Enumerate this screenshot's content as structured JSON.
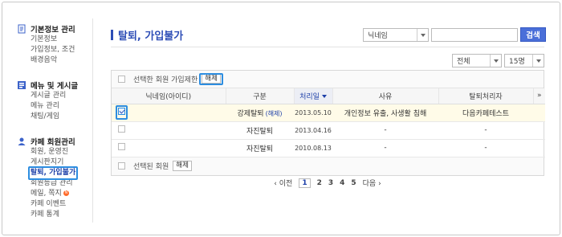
{
  "sidebar": {
    "sections": [
      {
        "title": "기본정보 관리",
        "items": [
          "기본정보",
          "가입정보, 조건",
          "배경음악"
        ]
      },
      {
        "title": "메뉴 및 게시글",
        "items": [
          "게시글 관리",
          "메뉴 관리",
          "채팅/게임"
        ]
      },
      {
        "title": "카페 회원관리",
        "items": [
          "회원, 운영진",
          "게시판지기",
          "탈퇴, 가입불가",
          "회원등급 관리",
          "메일, 쪽지",
          "카페 이벤트",
          "카페 통계"
        ]
      }
    ],
    "badge": "N"
  },
  "main": {
    "title": "탈퇴, 가입불가",
    "search": {
      "field_option": "닉네임",
      "button": "검색"
    },
    "filters": {
      "type": "전체",
      "page_size": "15명"
    },
    "bulk_top": {
      "text": "선택한 회원 가입제한",
      "button": "해제"
    },
    "table": {
      "headers": [
        "닉네임(아이디)",
        "구분",
        "처리일",
        "사유",
        "탈퇴처리자",
        "»"
      ],
      "rows": [
        {
          "nickname": "",
          "type": "강제탈퇴",
          "undo": "(해제)",
          "date": "2013.05.10",
          "reason": "개인정보 유출, 사생활 침해",
          "handler": "다음카페테스트"
        },
        {
          "nickname": "",
          "type": "자진탈퇴",
          "undo": "",
          "date": "2013.04.16",
          "reason": "-",
          "handler": "-"
        },
        {
          "nickname": "",
          "type": "자진탈퇴",
          "undo": "",
          "date": "2010.08.13",
          "reason": "-",
          "handler": "-"
        }
      ]
    },
    "bulk_bottom": {
      "text": "선택된 회원",
      "button": "해제"
    },
    "pagination": {
      "prev": "‹ 이전",
      "pages": [
        "1",
        "2",
        "3",
        "4",
        "5"
      ],
      "next": "다음 ›"
    }
  }
}
